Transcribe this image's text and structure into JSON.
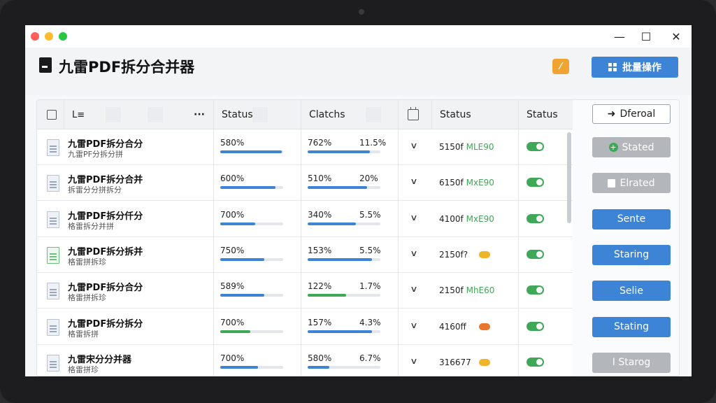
{
  "app": {
    "title": "九雷PDF拆分合并器"
  },
  "window_controls": {
    "minimize": "—",
    "maximize": "☐",
    "close": "✕"
  },
  "toolbar": {
    "tool_icon": "wrench-icon",
    "tool_glyph": "⁄",
    "batch_label": "批量操作"
  },
  "table": {
    "headers": {
      "name_icon": "L≡",
      "more": "···",
      "col1": "Status",
      "col2": "Clatchs",
      "col4": "Status",
      "col5": "Status",
      "action": "Dferoal"
    },
    "rows": [
      {
        "name": "九雷PDF拆分合分",
        "sub": "九雷PF分拆分拼",
        "icon": "blue",
        "p1": "580%",
        "p1_fill": 0.98,
        "p2a": "762%",
        "p2b": "11.5%",
        "p2_fill": 0.86,
        "code": "5150f",
        "tag": "MLE90",
        "dot": "",
        "action": "Stated",
        "action_style": "gray",
        "action_icon": "+"
      },
      {
        "name": "九雷PDF拆分合并",
        "sub": "拆雷分分拼拆分",
        "icon": "blue",
        "p1": "600%",
        "p1_fill": 0.88,
        "p2a": "510%",
        "p2b": "20%",
        "p2_fill": 0.82,
        "code": "6150f",
        "tag": "MxE90",
        "dot": "",
        "action": "Elrated",
        "action_style": "gray",
        "action_icon": "doc"
      },
      {
        "name": "九雷PDF拆分仟分",
        "sub": "格雷拆分并拼",
        "icon": "blue",
        "p1": "700%",
        "p1_fill": 0.56,
        "p2a": "340%",
        "p2b": "5.5%",
        "p2_fill": 0.66,
        "code": "4100f",
        "tag": "MxE90",
        "dot": "",
        "action": "Sente",
        "action_style": "blue",
        "action_icon": ""
      },
      {
        "name": "九雷PDF拆分拆并",
        "sub": "格雷拼拆珍",
        "icon": "green",
        "p1": "750%",
        "p1_fill": 0.7,
        "p2a": "153%",
        "p2b": "5.5%",
        "p2_fill": 0.88,
        "code": "2150f?",
        "tag": "",
        "dot": "#f0b429",
        "action": "Staring",
        "action_style": "blue",
        "action_icon": ""
      },
      {
        "name": "九雷PDF拆分合分",
        "sub": "格雷拼拆珍",
        "icon": "blue",
        "p1": "589%",
        "p1_fill": 0.7,
        "p2a": "122%",
        "p2b": "1.7%",
        "p2_fill": 0.53,
        "p2_green": true,
        "code": "2150f",
        "tag": "MhE60",
        "dot": "",
        "action": "Selie",
        "action_style": "blue",
        "action_icon": ""
      },
      {
        "name": "九雷PDF拆分拆分",
        "sub": "格雷拆拼",
        "icon": "blue",
        "p1": "700%",
        "p1_fill": 0.48,
        "p1_green": true,
        "p2a": "157%",
        "p2b": "4.3%",
        "p2_fill": 0.88,
        "code": "4160ff",
        "tag": "",
        "dot": "#e8762c",
        "action": "Stating",
        "action_style": "blue",
        "action_icon": ""
      },
      {
        "name": "九雷宋分分并器",
        "sub": "格雷拼珍",
        "icon": "blue",
        "p1": "700%",
        "p1_fill": 0.6,
        "p2a": "580%",
        "p2b": "6.7%",
        "p2_fill": 0.3,
        "code": "316677",
        "tag": "",
        "dot": "#f0b429",
        "action": "I Starog",
        "action_style": "gray",
        "action_icon": ""
      }
    ]
  },
  "colors": {
    "accent": "#3d84d6",
    "success": "#3ea856",
    "warning": "#f0b429",
    "orange": "#e8762c"
  }
}
